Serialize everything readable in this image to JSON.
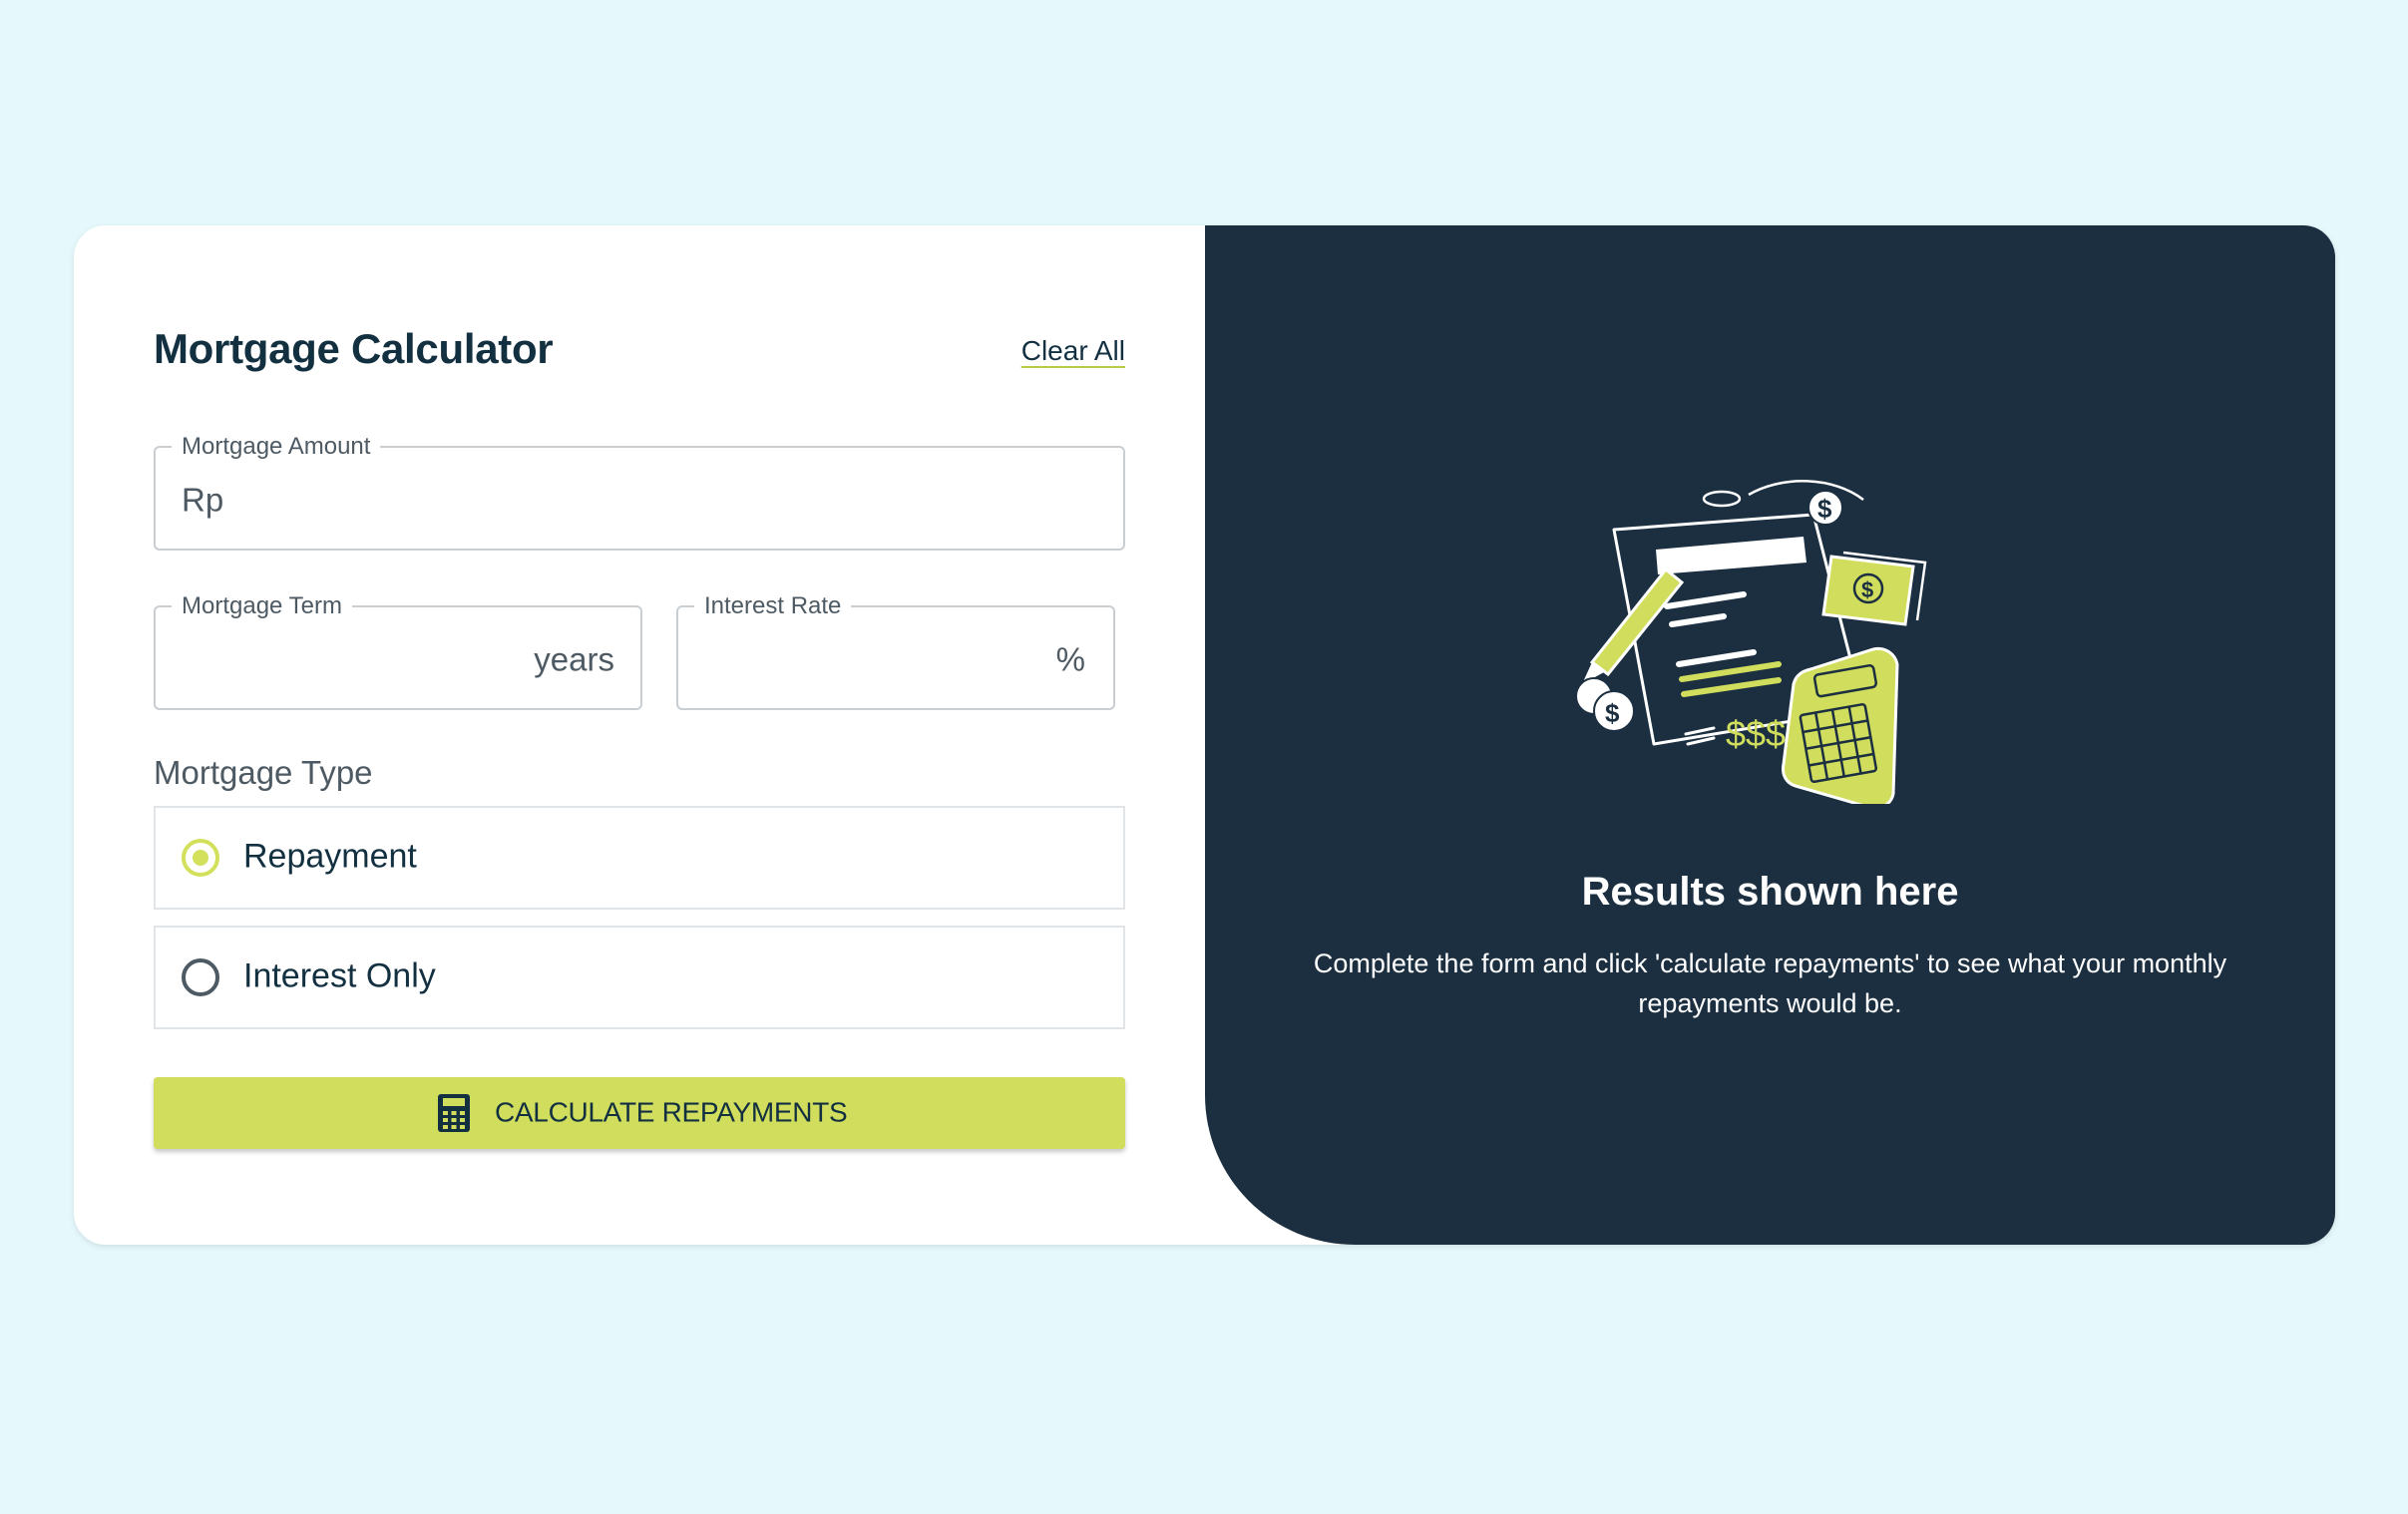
{
  "colors": {
    "background": "#e5f8fc",
    "accent": "#d1dd5c",
    "dark": "#1b2f41",
    "text": "#133041"
  },
  "header": {
    "title": "Mortgage Calculator",
    "clear_label": "Clear All"
  },
  "form": {
    "amount": {
      "label": "Mortgage Amount",
      "prefix": "Rp",
      "value": ""
    },
    "term": {
      "label": "Mortgage Term",
      "suffix": "years",
      "value": ""
    },
    "rate": {
      "label": "Interest Rate",
      "suffix": "%",
      "value": ""
    },
    "type": {
      "label": "Mortgage Type",
      "options": [
        {
          "label": "Repayment",
          "selected": true
        },
        {
          "label": "Interest Only",
          "selected": false
        }
      ]
    },
    "submit": {
      "label": "CALCULATE REPAYMENTS",
      "icon": "calculator-icon"
    }
  },
  "results": {
    "title": "Results shown here",
    "text": "Complete the form and click 'calculate repayments' to see what your monthly repayments would be.",
    "illustration": "empty-results-illustration"
  }
}
